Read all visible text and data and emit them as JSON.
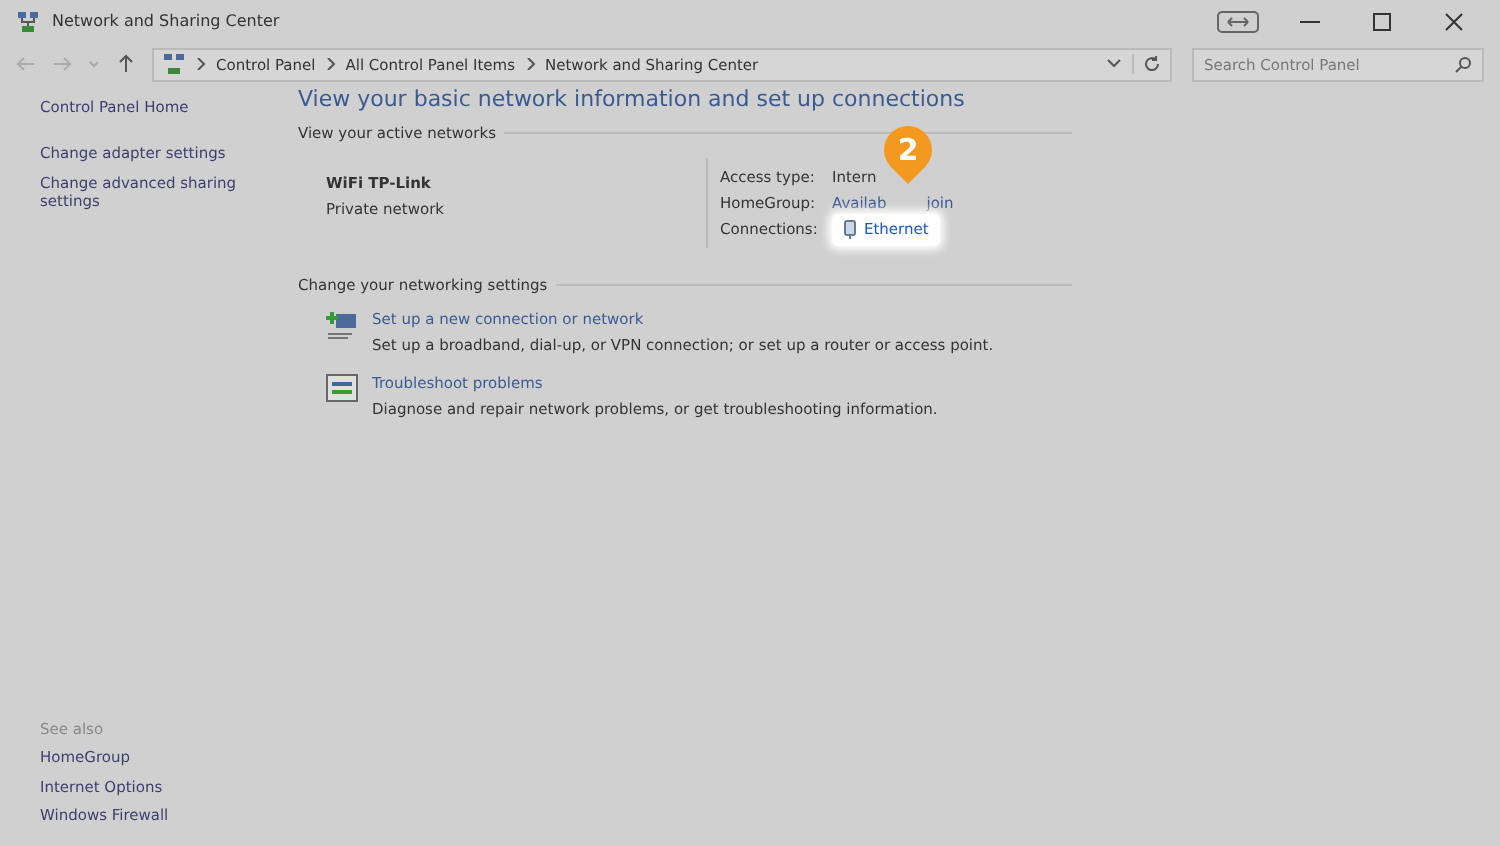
{
  "window": {
    "title": "Network and Sharing Center"
  },
  "breadcrumb": [
    "Control Panel",
    "All Control Panel Items",
    "Network and Sharing Center"
  ],
  "search": {
    "placeholder": "Search Control Panel"
  },
  "sidebar": {
    "items": [
      "Control Panel Home",
      "Change adapter settings",
      "Change advanced sharing settings"
    ],
    "see_also_title": "See also",
    "see_also": [
      "HomeGroup",
      "Internet Options",
      "Windows Firewall"
    ]
  },
  "heading": "View your basic network information and set up connections",
  "active_networks": {
    "title": "View your active networks",
    "name": "WiFi TP-Link",
    "type": "Private network",
    "access_label": "Access type:",
    "access_value": "Intern",
    "homegroup_label": "HomeGroup:",
    "homegroup_value_start": "Availab",
    "homegroup_value_end": "join",
    "connections_label": "Connections:",
    "connection": "Ethernet"
  },
  "settings": {
    "title": "Change your networking settings",
    "tasks": [
      {
        "kind": "setup",
        "link": "Set up a new connection or network",
        "desc": "Set up a broadband, dial-up, or VPN connection; or set up a router or access point."
      },
      {
        "kind": "troubleshoot",
        "link": "Troubleshoot problems",
        "desc": "Diagnose and repair network problems, or get troubleshooting information."
      }
    ]
  },
  "step_marker": "2"
}
